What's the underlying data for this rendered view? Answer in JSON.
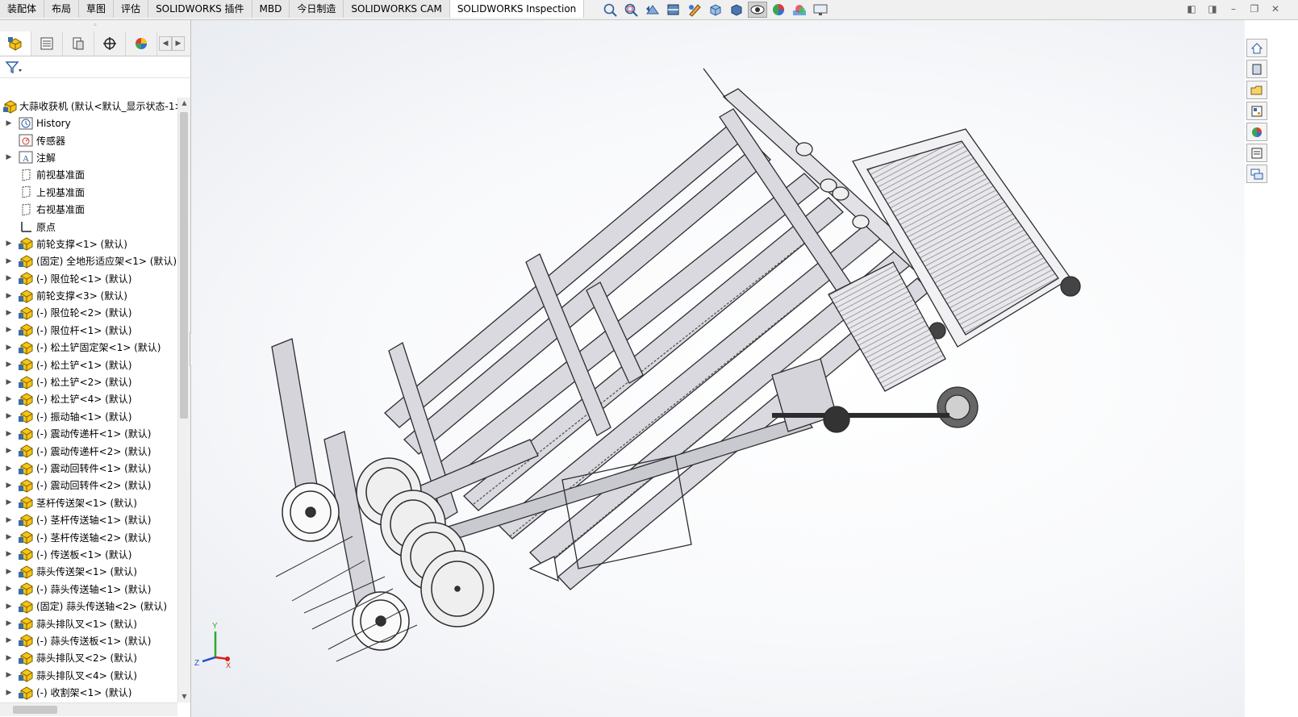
{
  "command_tabs": [
    {
      "label": "装配体",
      "active": false
    },
    {
      "label": "布局",
      "active": false
    },
    {
      "label": "草图",
      "active": false
    },
    {
      "label": "评估",
      "active": false
    },
    {
      "label": "SOLIDWORKS 插件",
      "active": false
    },
    {
      "label": "MBD",
      "active": false
    },
    {
      "label": "今日制造",
      "active": false
    },
    {
      "label": "SOLIDWORKS CAM",
      "active": false
    },
    {
      "label": "SOLIDWORKS Inspection",
      "active": true
    }
  ],
  "view_toolbar_icons": [
    "zoom-to-fit-icon",
    "zoom-to-area-icon",
    "previous-view-icon",
    "section-view-icon",
    "dynamic-annotation-icon",
    "view-orientation-icon",
    "display-style-icon",
    "hide-show-items-icon",
    "edit-appearance-icon",
    "apply-scene-icon",
    "view-settings-icon"
  ],
  "tree": {
    "root_label": "大蒜收获机 (默认<默认_显示状态-1>)",
    "items": [
      {
        "label": "History",
        "icon": "history-icon",
        "expandable": true
      },
      {
        "label": "传感器",
        "icon": "sensor-icon",
        "expandable": false
      },
      {
        "label": "注解",
        "icon": "annotation-icon",
        "expandable": true
      },
      {
        "label": "前视基准面",
        "icon": "plane-icon",
        "expandable": false
      },
      {
        "label": "上视基准面",
        "icon": "plane-icon",
        "expandable": false
      },
      {
        "label": "右视基准面",
        "icon": "plane-icon",
        "expandable": false
      },
      {
        "label": "原点",
        "icon": "origin-icon",
        "expandable": false
      },
      {
        "label": "前轮支撑<1> (默认)",
        "icon": "part-icon",
        "expandable": true
      },
      {
        "label": "(固定) 全地形适应架<1> (默认)",
        "icon": "part-icon",
        "expandable": true
      },
      {
        "label": "(-) 限位轮<1> (默认)",
        "icon": "part-icon",
        "expandable": true
      },
      {
        "label": "前轮支撑<3> (默认)",
        "icon": "part-icon",
        "expandable": true
      },
      {
        "label": "(-) 限位轮<2> (默认)",
        "icon": "part-icon",
        "expandable": true
      },
      {
        "label": "(-) 限位杆<1> (默认)",
        "icon": "part-icon",
        "expandable": true
      },
      {
        "label": "(-) 松土铲固定架<1> (默认)",
        "icon": "part-icon",
        "expandable": true
      },
      {
        "label": "(-) 松土铲<1> (默认)",
        "icon": "part-icon",
        "expandable": true
      },
      {
        "label": "(-) 松土铲<2> (默认)",
        "icon": "part-icon",
        "expandable": true
      },
      {
        "label": "(-) 松土铲<4> (默认)",
        "icon": "part-icon",
        "expandable": true
      },
      {
        "label": "(-) 振动轴<1> (默认)",
        "icon": "part-icon",
        "expandable": true
      },
      {
        "label": "(-) 震动传递杆<1> (默认)",
        "icon": "part-icon",
        "expandable": true
      },
      {
        "label": "(-) 震动传递杆<2> (默认)",
        "icon": "part-icon",
        "expandable": true
      },
      {
        "label": "(-) 震动回转件<1> (默认)",
        "icon": "part-icon",
        "expandable": true
      },
      {
        "label": "(-) 震动回转件<2> (默认)",
        "icon": "part-icon",
        "expandable": true
      },
      {
        "label": "茎杆传送架<1> (默认)",
        "icon": "part-icon",
        "expandable": true
      },
      {
        "label": "(-) 茎杆传送轴<1> (默认)",
        "icon": "part-icon",
        "expandable": true
      },
      {
        "label": "(-) 茎杆传送轴<2> (默认)",
        "icon": "part-icon",
        "expandable": true
      },
      {
        "label": "(-) 传送板<1> (默认)",
        "icon": "part-icon",
        "expandable": true
      },
      {
        "label": "蒜头传送架<1> (默认)",
        "icon": "part-icon",
        "expandable": true
      },
      {
        "label": "(-) 蒜头传送轴<1> (默认)",
        "icon": "part-icon",
        "expandable": true
      },
      {
        "label": "(固定) 蒜头传送轴<2> (默认)",
        "icon": "part-icon",
        "expandable": true
      },
      {
        "label": "蒜头排队叉<1> (默认)",
        "icon": "part-icon",
        "expandable": true
      },
      {
        "label": "(-) 蒜头传送板<1> (默认)",
        "icon": "part-icon",
        "expandable": true
      },
      {
        "label": "蒜头排队叉<2> (默认)",
        "icon": "part-icon",
        "expandable": true
      },
      {
        "label": "蒜头排队叉<4> (默认)",
        "icon": "part-icon",
        "expandable": true
      },
      {
        "label": "(-) 收割架<1> (默认)",
        "icon": "part-icon",
        "expandable": true
      }
    ]
  },
  "triad": {
    "x_label": "X",
    "y_label": "Y",
    "z_label": "Z"
  },
  "colors": {
    "accent": "#f0c020",
    "tab_bg": "#e8e8e8",
    "part_yellow": "#f5c518",
    "part_blue": "#3a6ea5"
  }
}
